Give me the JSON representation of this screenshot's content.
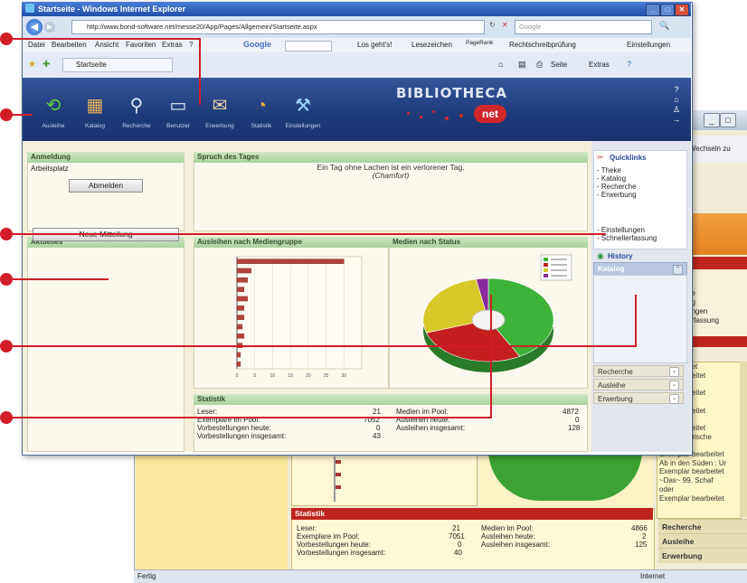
{
  "browser": {
    "title": "Startseite - Windows Internet Explorer",
    "url": "http://www.bond-software.net/messe20/App/Pages/Allgemein/Startseite.aspx",
    "search_placeholder": "Google",
    "menu": [
      "Datei",
      "Bearbeiten",
      "Ansicht",
      "Favoriten",
      "Extras",
      "?"
    ],
    "google_label": "Google",
    "toolbar_items": [
      "Los geht's!",
      "Lesezeichen",
      "PageRank",
      "Rechtschreibprüfung",
      "Einstellungen"
    ],
    "tab_label": "Startseite",
    "cmd_items": [
      "Seite",
      "Extras"
    ]
  },
  "app": {
    "logo_text": "BIBLIOTHECA",
    "logo_badge": "net",
    "tools": [
      "Ausleihe",
      "Katalog",
      "Recherche",
      "Benutzer",
      "Erwerbung",
      "Statistik",
      "Einstellungen"
    ],
    "anmeldung": {
      "title": "Anmeldung",
      "label": "Arbeitsplatz",
      "button": "Abmelden"
    },
    "aktuelles": {
      "title": "Aktuelles",
      "button": "Neue Mitteilung"
    },
    "spruch": {
      "title": "Spruch des Tages",
      "text": "Ein Tag ohne Lachen ist ein verlorener Tag.",
      "author": "(Chamfort)"
    },
    "quicklinks": {
      "title": "Quicklinks",
      "items": [
        "- Theke",
        "- Katalog",
        "- Recherche",
        "- Erwerbung",
        "- Einstellungen",
        "- Schnellerfassung"
      ]
    },
    "history": "History",
    "katalog": "Katalog",
    "side_buttons": [
      "Recherche",
      "Ausleihe",
      "Erwerbung"
    ],
    "statistik": {
      "title": "Statistik",
      "left": [
        [
          "Leser:",
          "21"
        ],
        [
          "Exemplare im Pool:",
          "7052"
        ],
        [
          "Vorbestellungen heute:",
          "0"
        ],
        [
          "Vorbestellungen insgesamt:",
          "43"
        ]
      ],
      "right": [
        [
          "Medien im Pool:",
          "4872"
        ],
        [
          "Ausleihen heute:",
          "0"
        ],
        [
          "Ausleihen insgesamt:",
          "128"
        ]
      ]
    }
  },
  "chart_data": [
    {
      "type": "bar",
      "title": "Ausleihen nach Mediengruppe",
      "orientation": "horizontal",
      "values": [
        30,
        4,
        3,
        2,
        3,
        2,
        2,
        1.5,
        2,
        1.5,
        1,
        1
      ],
      "xticks": [
        "0",
        "5",
        "10",
        "15",
        "20",
        "25",
        "30"
      ],
      "xlim": [
        0,
        35
      ]
    },
    {
      "type": "pie",
      "title": "Medien nach Status",
      "legend_placement": "top-right",
      "slices": [
        {
          "value": 42,
          "color": "#3db33a"
        },
        {
          "value": 28,
          "color": "#c41e1e"
        },
        {
          "value": 27,
          "color": "#d8c82a"
        },
        {
          "value": 3,
          "color": "#8a2a9a"
        }
      ]
    }
  ],
  "back_window": {
    "nav_text": "Wechseln zu",
    "list": [
      "he",
      "ng",
      "ungen",
      "erfassung"
    ],
    "log": [
      "n bearbeitet",
      "plar bearbeitet",
      "atze maus",
      "plar bearbeitet",
      "schspiel",
      "plar bearbeitet",
      "Herr der",
      "plar bearbeitet",
      "Die - bayerische",
      "Vog",
      "Exemplar bearbeitet",
      "Ab in den Süden : Ur",
      "Exemplar bearbeitet",
      "~Das~ 99. Schaf",
      "oder",
      "Exemplar bearbeitet"
    ],
    "side": [
      "Recherche",
      "Ausleihe",
      "Erwerbung"
    ],
    "stat_title": "Statistik",
    "stat_left": [
      [
        "Leser:",
        "21"
      ],
      [
        "Exemplare im Pool:",
        "7051"
      ],
      [
        "Vorbestellungen heute:",
        "0"
      ],
      [
        "Vorbestellungen insgesamt:",
        "40"
      ]
    ],
    "stat_right": [
      [
        "Medien im Pool:",
        "4866"
      ],
      [
        "Ausleihen heute:",
        "2"
      ],
      [
        "Ausleihen insgesamt:",
        "125"
      ]
    ],
    "status_left": "Fertig",
    "status_right": "Internet"
  }
}
